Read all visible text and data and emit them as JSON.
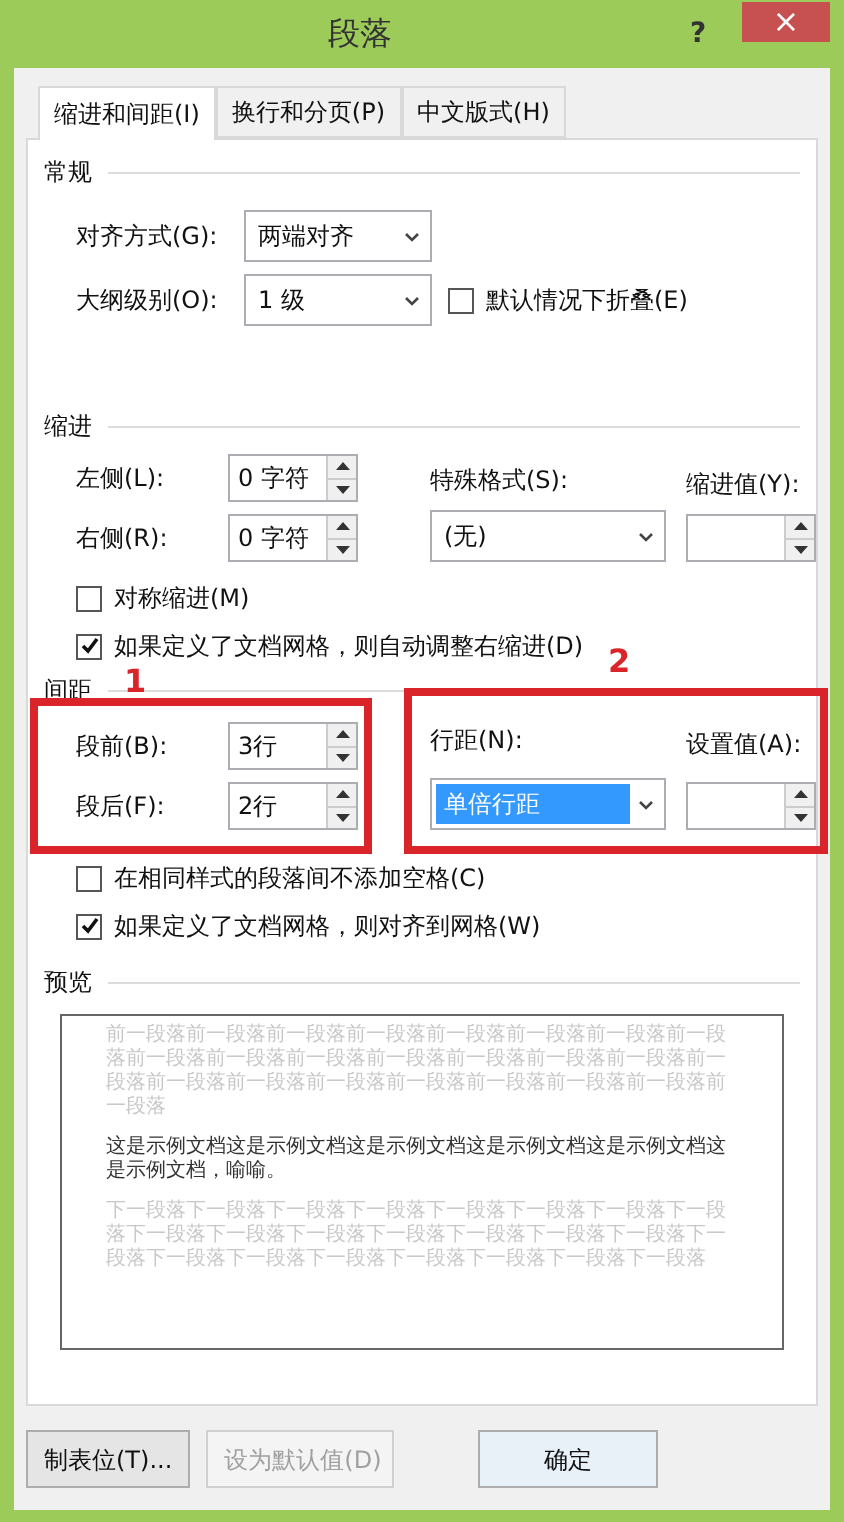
{
  "window": {
    "title": "段落",
    "help": "?",
    "close": "×"
  },
  "tabs": [
    {
      "label": "缩进和间距(I)",
      "selected": true
    },
    {
      "label": "换行和分页(P)",
      "selected": false
    },
    {
      "label": "中文版式(H)",
      "selected": false
    }
  ],
  "general": {
    "heading": "常规",
    "alignment": {
      "label": "对齐方式(G):",
      "value": "两端对齐"
    },
    "outline": {
      "label": "大纲级别(O):",
      "value": "1 级"
    },
    "collapse": {
      "label": "默认情况下折叠(E)",
      "checked": false
    }
  },
  "indent": {
    "heading": "缩进",
    "left": {
      "label": "左侧(L):",
      "value": "0 字符"
    },
    "right": {
      "label": "右侧(R):",
      "value": "0 字符"
    },
    "special": {
      "label": "特殊格式(S):",
      "value": "(无)"
    },
    "by": {
      "label": "缩进值(Y):"
    },
    "mirror": {
      "label": "对称缩进(M)",
      "checked": false
    },
    "auto_adjust": {
      "label": "如果定义了文档网格，则自动调整右缩进(D)",
      "checked": true
    }
  },
  "spacing": {
    "heading": "间距",
    "before": {
      "label": "段前(B):",
      "value": "3行"
    },
    "after": {
      "label": "段后(F):",
      "value": "2行"
    },
    "line_spacing": {
      "label": "行距(N):",
      "value": "单倍行距",
      "highlighted": true
    },
    "at": {
      "label": "设置值(A):"
    },
    "no_space": {
      "label": "在相同样式的段落间不添加空格(C)",
      "checked": false
    },
    "snap": {
      "label": "如果定义了文档网格，则对齐到网格(W)",
      "checked": true
    }
  },
  "annotations": [
    {
      "number": "1"
    },
    {
      "number": "2"
    }
  ],
  "preview": {
    "heading": "预览",
    "previous": "前一段落前一段落前一段落前一段落前一段落前一段落前一段落前一段落前一段落前一段落前一段落前一段落前一段落前一段落前一段落前一段落前一段落前一段落前一段落前一段落前一段落前一段落前一段落前一段落",
    "sample": "这是示例文档这是示例文档这是示例文档这是示例文档这是示例文档这是示例文档，喻喻。",
    "next": "下一段落下一段落下一段落下一段落下一段落下一段落下一段落下一段落下一段落下一段落下一段落下一段落下一段落下一段落下一段落下一段落下一段落下一段落下一段落下一段落下一段落下一段落下一段落"
  },
  "buttons": [
    {
      "label": "制表位(T)...",
      "disabled": false
    },
    {
      "label": "设为默认值(D)",
      "disabled": true
    },
    {
      "label": "确定",
      "disabled": false
    }
  ]
}
